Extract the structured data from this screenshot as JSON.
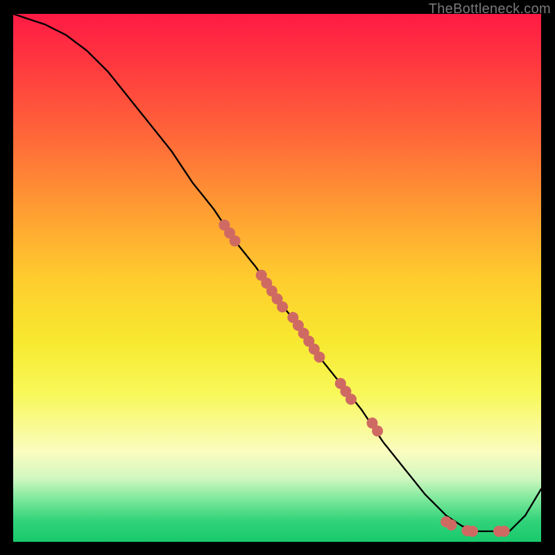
{
  "watermark": "TheBottleneck.com",
  "colors": {
    "dot_fill": "#cf6a63",
    "curve_stroke": "#000000"
  },
  "chart_data": {
    "type": "line",
    "title": "",
    "xlabel": "",
    "ylabel": "",
    "xlim": [
      0,
      100
    ],
    "ylim": [
      0,
      100
    ],
    "grid": false,
    "legend": false,
    "series": [
      {
        "name": "bottleneck-curve",
        "x": [
          0,
          3,
          6,
          10,
          14,
          18,
          22,
          26,
          30,
          34,
          38,
          42,
          46,
          50,
          54,
          58,
          62,
          66,
          70,
          74,
          78,
          82,
          85,
          88,
          91,
          94,
          97,
          100
        ],
        "y": [
          100,
          99,
          98,
          96,
          93,
          89,
          84,
          79,
          74,
          68,
          63,
          57,
          52,
          46,
          41,
          35,
          30,
          25,
          19,
          14,
          9,
          5,
          3,
          2,
          2,
          2,
          5,
          10
        ]
      }
    ],
    "points_on_curve": [
      {
        "name": "cluster-upper",
        "x": 40,
        "y": 60
      },
      {
        "name": "cluster-upper",
        "x": 41,
        "y": 58.5
      },
      {
        "name": "cluster-upper",
        "x": 42,
        "y": 57
      },
      {
        "name": "cluster-mid-high",
        "x": 47,
        "y": 50.5
      },
      {
        "name": "cluster-mid-high",
        "x": 48,
        "y": 49
      },
      {
        "name": "cluster-mid-high",
        "x": 49,
        "y": 47.5
      },
      {
        "name": "cluster-mid-high",
        "x": 50,
        "y": 46
      },
      {
        "name": "cluster-mid-high",
        "x": 51,
        "y": 44.5
      },
      {
        "name": "cluster-mid",
        "x": 53,
        "y": 42.5
      },
      {
        "name": "cluster-mid",
        "x": 54,
        "y": 41
      },
      {
        "name": "cluster-mid",
        "x": 55,
        "y": 39.5
      },
      {
        "name": "cluster-mid",
        "x": 56,
        "y": 38
      },
      {
        "name": "cluster-mid",
        "x": 57,
        "y": 36.5
      },
      {
        "name": "cluster-mid",
        "x": 58,
        "y": 35
      },
      {
        "name": "cluster-low",
        "x": 62,
        "y": 30
      },
      {
        "name": "cluster-low",
        "x": 63,
        "y": 28.5
      },
      {
        "name": "cluster-low",
        "x": 64,
        "y": 27
      },
      {
        "name": "cluster-lower",
        "x": 68,
        "y": 22.5
      },
      {
        "name": "cluster-lower",
        "x": 69,
        "y": 21
      },
      {
        "name": "floor-points",
        "x": 82,
        "y": 3.8
      },
      {
        "name": "floor-points",
        "x": 83,
        "y": 3.2
      },
      {
        "name": "floor-points",
        "x": 86,
        "y": 2.1
      },
      {
        "name": "floor-points",
        "x": 87,
        "y": 2.0
      },
      {
        "name": "floor-points",
        "x": 92,
        "y": 2.0
      },
      {
        "name": "floor-points",
        "x": 93,
        "y": 2.0
      }
    ]
  }
}
